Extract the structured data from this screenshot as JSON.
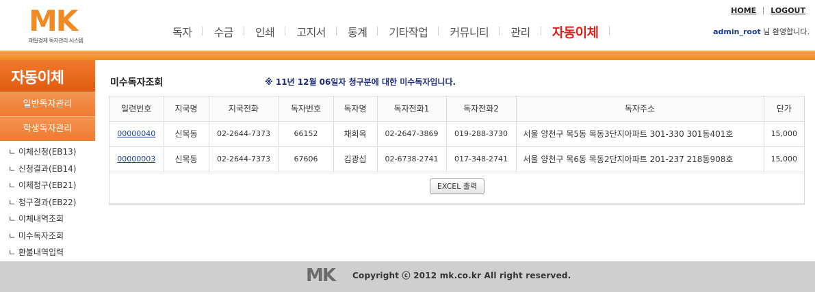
{
  "header": {
    "logo_text": "MK",
    "logo_sub": "매일경제 독자관리 시스템",
    "nav": [
      "독자",
      "수금",
      "인쇄",
      "고지서",
      "통계",
      "기타작업",
      "커뮤니티",
      "관리",
      "자동이체"
    ],
    "home_link": "HOME",
    "logout_link": "LOGOUT",
    "user_id": "admin_root",
    "welcome_suffix": "님  환영합니다."
  },
  "sidebar": {
    "title": "자동이체",
    "main_items": [
      "일반독자관리",
      "학생독자관리"
    ],
    "sub_items": [
      "ㄴ 이체신청(EB13)",
      "ㄴ 신청결과(EB14)",
      "ㄴ 이체청구(EB21)",
      "ㄴ 청구결과(EB22)",
      "ㄴ 이체내역조회",
      "ㄴ 미수독자조회",
      "ㄴ 환불내역입력"
    ]
  },
  "main": {
    "page_title": "미수독자조회",
    "notice": "※ 11년 12월 06일자 청구분에 대한 미수독자입니다.",
    "columns": [
      "일련번호",
      "지국명",
      "지국전화",
      "독자번호",
      "독자명",
      "독자전화1",
      "독자전화2",
      "독자주소",
      "단가"
    ],
    "rows": [
      [
        "00000040",
        "신목동",
        "02-2644-7373",
        "66152",
        "채희옥",
        "02-2647-3869",
        "019-288-3730",
        "서울 양천구 목5동 목동3단지아파트 301-330   301동401호",
        "15,000"
      ],
      [
        "00000003",
        "신목동",
        "02-2644-7373",
        "67606",
        "김광섭",
        "02-6738-2741",
        "017-348-2741",
        "서울 양천구 목6동 목동2단지아파트 201-237   218동908호",
        "15,000"
      ]
    ],
    "excel_button": "EXCEL 출력"
  },
  "footer": {
    "logo_text": "MK",
    "copyright": "Copyright ⓒ 2012 mk.co.kr All right reserved."
  },
  "colors": {
    "brand_orange": "#f08a24",
    "active_nav": "#e0201a",
    "notice_blue": "#1b2a7a"
  }
}
